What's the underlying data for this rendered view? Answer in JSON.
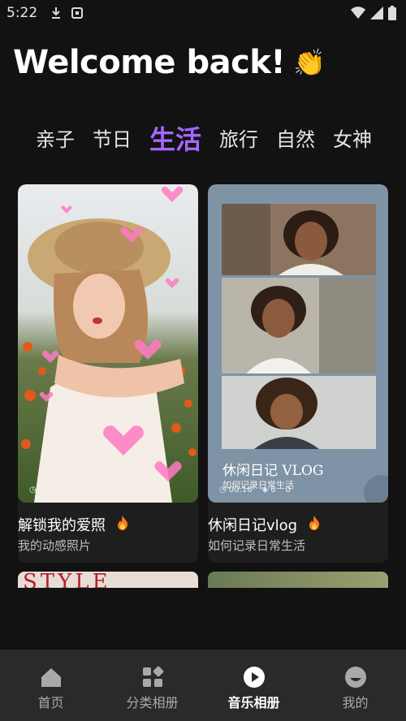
{
  "status_bar": {
    "time": "5:22"
  },
  "header": {
    "welcome": "Welcome back!",
    "wave_emoji": "👏"
  },
  "tabs": [
    {
      "label": "亲子"
    },
    {
      "label": "节日"
    },
    {
      "label": "生活"
    },
    {
      "label": "旅行"
    },
    {
      "label": "自然"
    },
    {
      "label": "女神"
    }
  ],
  "active_tab": "生活",
  "cards": [
    {
      "title": "解锁我的爱照",
      "subtitle": "我的动感照片",
      "duration": "00:15",
      "layers": "2",
      "count": "0"
    },
    {
      "title": "休闲日记vlog",
      "subtitle": "如何记录日常生活",
      "duration": "00:16",
      "layers": "6",
      "count": "0",
      "overlay_title": "休闲日记 VLOG",
      "overlay_sub": "如何记录日常生活"
    }
  ],
  "peek_card_text": "STYLE",
  "bottom_nav": [
    {
      "label": "首页",
      "icon": "home-icon"
    },
    {
      "label": "分类相册",
      "icon": "category-icon"
    },
    {
      "label": "音乐相册",
      "icon": "play-icon"
    },
    {
      "label": "我的",
      "icon": "profile-icon"
    }
  ],
  "colors": {
    "accent": "#a566ff",
    "background": "#121212",
    "nav_background": "#2a2a2a",
    "fire": "#ff7a1a"
  }
}
